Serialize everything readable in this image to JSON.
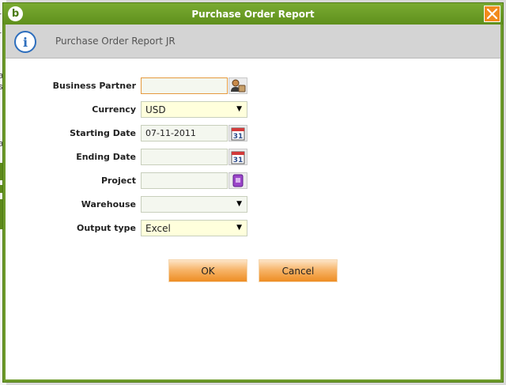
{
  "window": {
    "title": "Purchase Order Report",
    "logo_glyph": "b"
  },
  "info": {
    "message": "Purchase Order Report JR"
  },
  "form": {
    "business_partner": {
      "label": "Business Partner",
      "value": ""
    },
    "currency": {
      "label": "Currency",
      "value": "USD"
    },
    "starting_date": {
      "label": "Starting Date",
      "value": "07-11-2011"
    },
    "ending_date": {
      "label": "Ending Date",
      "value": ""
    },
    "project": {
      "label": "Project",
      "value": ""
    },
    "warehouse": {
      "label": "Warehouse",
      "value": ""
    },
    "output_type": {
      "label": "Output type",
      "value": "Excel"
    }
  },
  "calendar_day": "31",
  "buttons": {
    "ok": "OK",
    "cancel": "Cancel"
  },
  "background_fragments": [
    "r",
    "r",
    "a",
    "s",
    "a"
  ],
  "icons": {
    "logo": "app-logo-icon",
    "close": "close-icon",
    "info": "info-icon",
    "partner_search": "business-partner-search-icon",
    "calendar": "calendar-icon",
    "project_search": "project-search-icon",
    "dropdown": "chevron-down-icon"
  },
  "colors": {
    "title_bar": "#6d9a2a",
    "close_button": "#f28a1c",
    "button_orange": "#ee8d23",
    "info_blue": "#2d6ebd",
    "currency_highlight": "#ffffdc"
  }
}
